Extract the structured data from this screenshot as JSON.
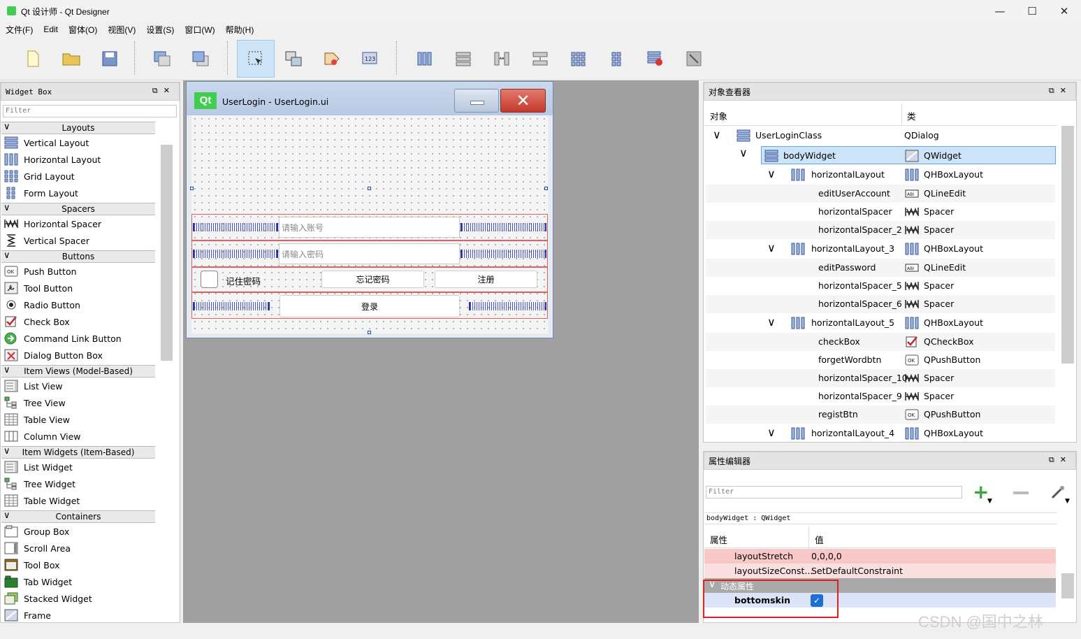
{
  "window": {
    "title": "Qt 设计师 - Qt Designer",
    "min": "—",
    "max": "☐",
    "close": "✕"
  },
  "menu": [
    "文件(F)",
    "Edit",
    "窗体(O)",
    "视图(V)",
    "设置(S)",
    "窗口(W)",
    "帮助(H)"
  ],
  "widget_box": {
    "title": "Widget Box",
    "filter_placeholder": "Filter",
    "categories": {
      "layouts": "Layouts",
      "spacers": "Spacers",
      "buttons": "Buttons",
      "item_views": "Item Views (Model-Based)",
      "item_widgets": "Item Widgets (Item-Based)",
      "containers": "Containers"
    },
    "items": {
      "vertical_layout": "Vertical Layout",
      "horizontal_layout": "Horizontal Layout",
      "grid_layout": "Grid Layout",
      "form_layout": "Form Layout",
      "horizontal_spacer": "Horizontal Spacer",
      "vertical_spacer": "Vertical Spacer",
      "push_button": "Push Button",
      "tool_button": "Tool Button",
      "radio_button": "Radio Button",
      "check_box": "Check Box",
      "command_link_button": "Command Link Button",
      "dialog_button_box": "Dialog Button Box",
      "list_view": "List View",
      "tree_view": "Tree View",
      "table_view": "Table View",
      "column_view": "Column View",
      "list_widget": "List Widget",
      "tree_widget": "Tree Widget",
      "table_widget": "Table Widget",
      "group_box": "Group Box",
      "scroll_area": "Scroll Area",
      "tool_box": "Tool Box",
      "tab_widget": "Tab Widget",
      "stacked_widget": "Stacked Widget",
      "frame": "Frame"
    }
  },
  "form": {
    "logo": "Qt",
    "caption": "UserLogin - UserLogin.ui",
    "account_placeholder": "请输入账号",
    "password_placeholder": "请输入密码",
    "remember": "记住密码",
    "forget": "忘记密码",
    "register": "注册",
    "login": "登录"
  },
  "object_inspector": {
    "title": "对象查看器",
    "col_object": "对象",
    "col_class": "类",
    "rows": [
      {
        "name": "UserLoginClass",
        "cls": "QDialog"
      },
      {
        "name": "bodyWidget",
        "cls": "QWidget"
      },
      {
        "name": "horizontalLayout",
        "cls": "QHBoxLayout"
      },
      {
        "name": "editUserAccount",
        "cls": "QLineEdit"
      },
      {
        "name": "horizontalSpacer",
        "cls": "Spacer"
      },
      {
        "name": "horizontalSpacer_2",
        "cls": "Spacer"
      },
      {
        "name": "horizontalLayout_3",
        "cls": "QHBoxLayout"
      },
      {
        "name": "editPassword",
        "cls": "QLineEdit"
      },
      {
        "name": "horizontalSpacer_5",
        "cls": "Spacer"
      },
      {
        "name": "horizontalSpacer_6",
        "cls": "Spacer"
      },
      {
        "name": "horizontalLayout_5",
        "cls": "QHBoxLayout"
      },
      {
        "name": "checkBox",
        "cls": "QCheckBox"
      },
      {
        "name": "forgetWordbtn",
        "cls": "QPushButton"
      },
      {
        "name": "horizontalSpacer_10",
        "cls": "Spacer"
      },
      {
        "name": "horizontalSpacer_9",
        "cls": "Spacer"
      },
      {
        "name": "registBtn",
        "cls": "QPushButton"
      },
      {
        "name": "horizontalLayout_4",
        "cls": "QHBoxLayout"
      }
    ]
  },
  "property_editor": {
    "title": "属性编辑器",
    "filter_placeholder": "Filter",
    "object_label": "bodyWidget : QWidget",
    "col_property": "属性",
    "col_value": "值",
    "rows": [
      {
        "key": "layoutStretch",
        "value": "0,0,0,0"
      },
      {
        "key": "layoutSizeConst...",
        "value": "SetDefaultConstraint"
      }
    ],
    "dynamic_group": "动态属性",
    "dynamic_prop": "bottomskin",
    "dynamic_checked": true
  },
  "watermark": "CSDN @国中之林",
  "colors": {
    "accent": "#41cd52",
    "selection": "#cce4f7",
    "highlight_red": "#e02020"
  }
}
